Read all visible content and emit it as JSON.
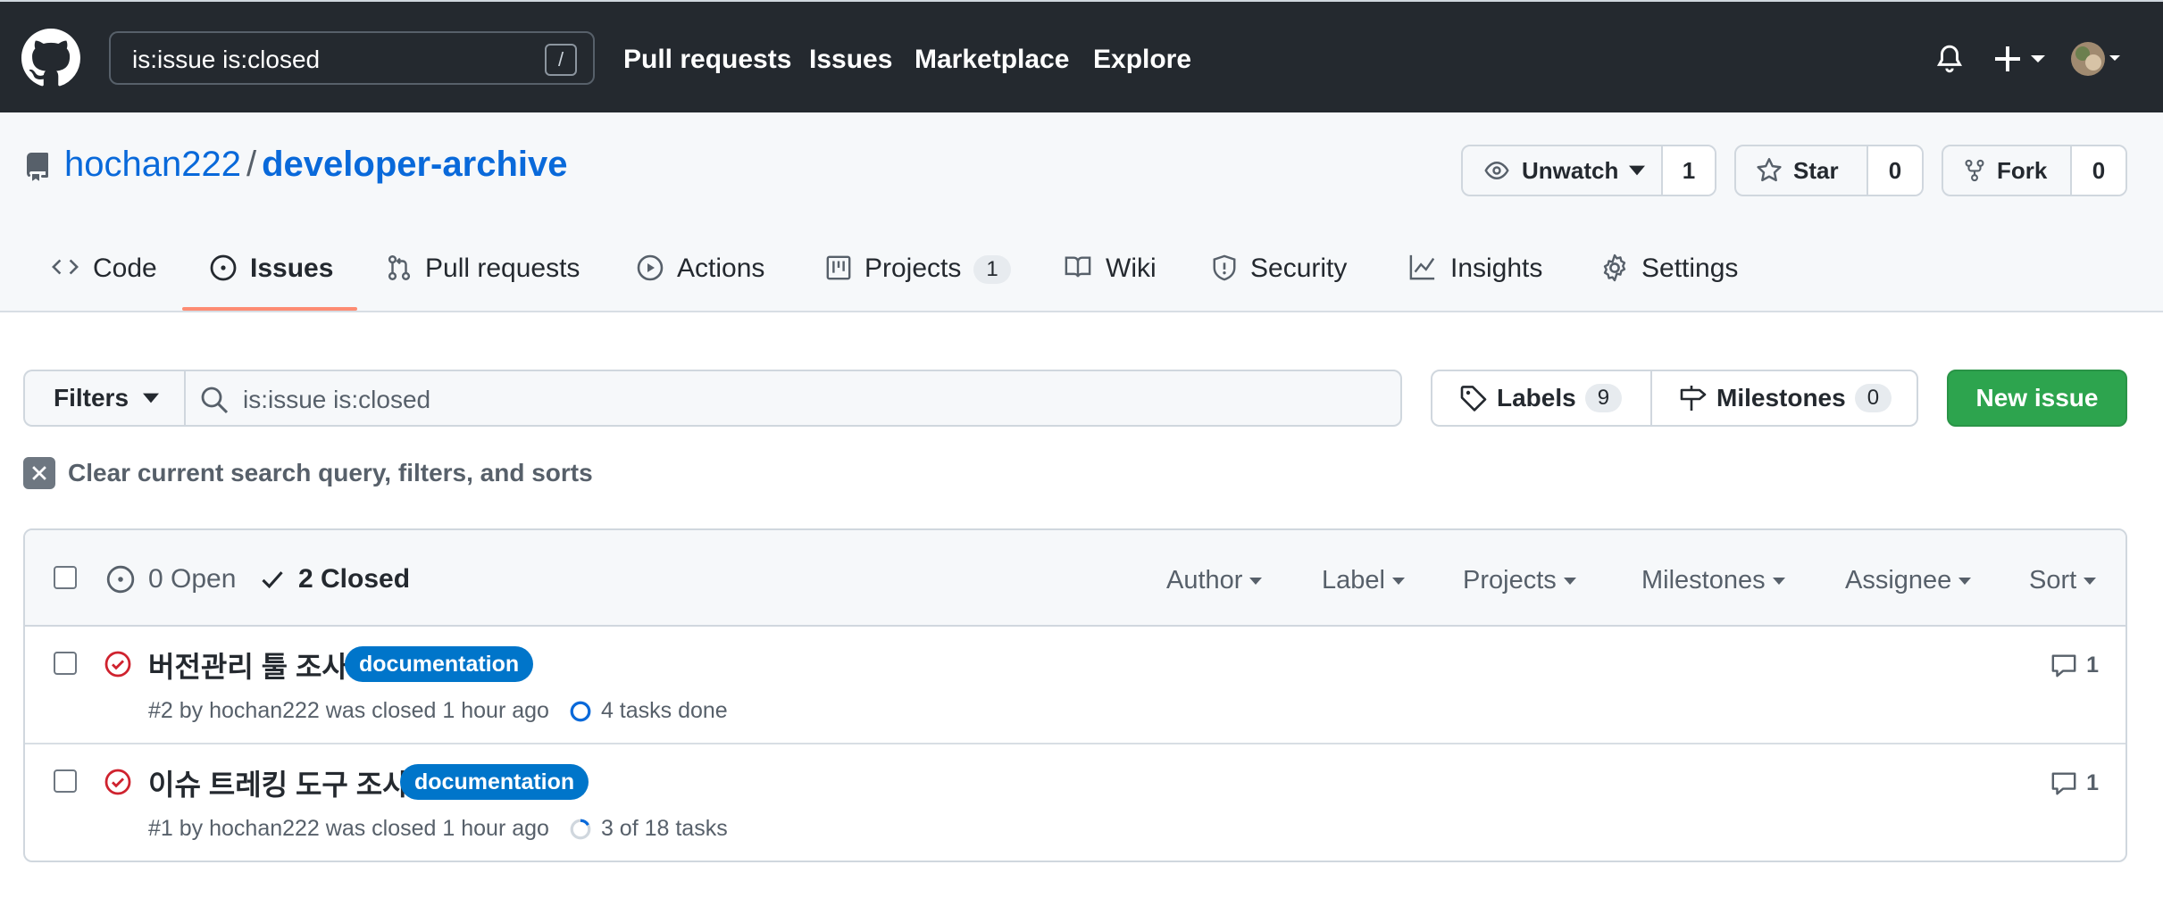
{
  "header": {
    "search_value": "is:issue is:closed",
    "search_shortcut": "/",
    "nav": [
      "Pull requests",
      "Issues",
      "Marketplace",
      "Explore"
    ]
  },
  "repo": {
    "owner": "hochan222",
    "separator": "/",
    "name": "developer-archive",
    "watch_label": "Unwatch",
    "watch_count": "1",
    "star_label": "Star",
    "star_count": "0",
    "fork_label": "Fork",
    "fork_count": "0"
  },
  "tabs": {
    "code": "Code",
    "issues": "Issues",
    "pulls": "Pull requests",
    "actions": "Actions",
    "projects": "Projects",
    "projects_count": "1",
    "wiki": "Wiki",
    "security": "Security",
    "insights": "Insights",
    "settings": "Settings"
  },
  "filters": {
    "filters_label": "Filters",
    "query": "is:issue is:closed",
    "labels_label": "Labels",
    "labels_count": "9",
    "milestones_label": "Milestones",
    "milestones_count": "0",
    "new_issue_label": "New issue",
    "clear_label": "Clear current search query, filters, and sorts"
  },
  "list_header": {
    "open": "0 Open",
    "closed": "2 Closed",
    "author": "Author",
    "label": "Label",
    "projects": "Projects",
    "milestones": "Milestones",
    "assignee": "Assignee",
    "sort": "Sort"
  },
  "issues": [
    {
      "title": "버전관리 툴 조사",
      "label": "documentation",
      "meta": "#2 by hochan222 was closed 1 hour ago",
      "tasks": "4 tasks done",
      "tasks_progress": 1.0,
      "comments": "1"
    },
    {
      "title": "이슈 트레킹 도구 조사",
      "label": "documentation",
      "meta": "#1 by hochan222 was closed 1 hour ago",
      "tasks": "3 of 18 tasks",
      "tasks_progress": 0.1667,
      "comments": "1"
    }
  ],
  "colors": {
    "header_bg": "#24292f",
    "link": "#0969da",
    "closed_icon": "#cf222e",
    "label_documentation": "#0075ca",
    "new_issue_green": "#2da44e",
    "tab_underline": "#fd8c73"
  }
}
